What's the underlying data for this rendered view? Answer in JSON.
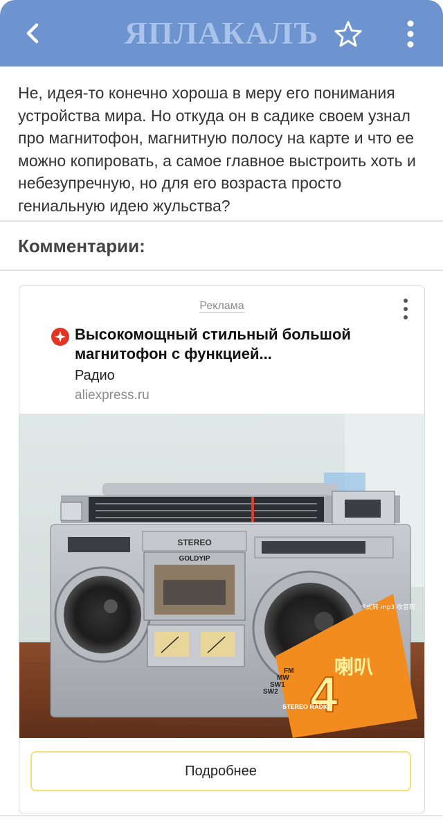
{
  "header": {
    "logo_text": "ЯПЛАКАЛЪ",
    "back_icon": "chevron-left-icon",
    "star_icon": "star-icon",
    "menu_icon": "more-vertical-icon",
    "background_color": "#6d94cf"
  },
  "post": {
    "text": "Не, идея-то конечно хороша в меру его понимания устройства мира. Но откуда он в садике своем узнал про магнитофон, магнитную полосу на карте и что ее можно копировать, а самое главное выстроить хоть и небезупречную, но для его возраста просто гениальную идею жульства?"
  },
  "comments": {
    "title": "Комментарии:"
  },
  "ad": {
    "label": "Реклама",
    "title": "Высокомощный стильный большой магнитофон с функцией...",
    "subtitle": "Радио",
    "domain": "aliexpress.ru",
    "button_label": "Подробнее",
    "brand_icon": "aliexpress-star-icon",
    "button_border_color": "#f3e27a",
    "product_image": {
      "brand_text": "GOLDYIP",
      "stereo_text": "STEREO",
      "sticker_number": "4",
      "sticker_text": "喇叭",
      "band_labels": [
        "FM",
        "MW",
        "SW1",
        "SW2"
      ],
      "sticker_footer": "STEREO RADIO",
      "sticker_corner": "卡式转 mp3 收音转"
    }
  }
}
